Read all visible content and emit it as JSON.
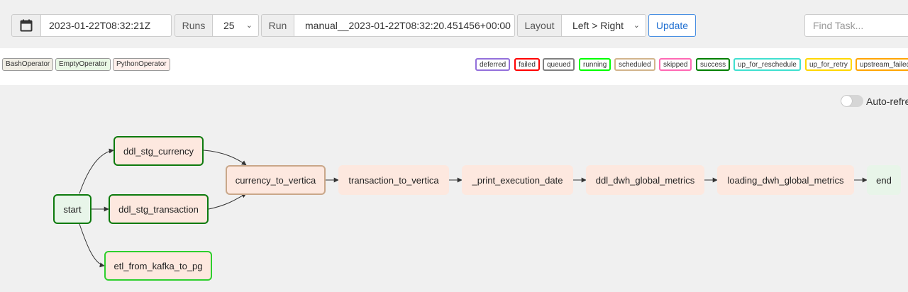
{
  "toolbar": {
    "date_value": "2023-01-22T08:32:21Z",
    "runs_label": "Runs",
    "runs_value": "25",
    "run_label": "Run",
    "run_value": "manual__2023-01-22T08:32:20.451456+00:00",
    "layout_label": "Layout",
    "layout_value": "Left > Right",
    "update_label": "Update",
    "find_placeholder": "Find Task..."
  },
  "operators": [
    {
      "label": "BashOperator",
      "bg": "#f0ede4"
    },
    {
      "label": "EmptyOperator",
      "bg": "#e8f7e4"
    },
    {
      "label": "PythonOperator",
      "bg": "#ffefeb"
    }
  ],
  "states": [
    {
      "label": "deferred",
      "color": "#9370db"
    },
    {
      "label": "failed",
      "color": "#ff0000"
    },
    {
      "label": "queued",
      "color": "#808080"
    },
    {
      "label": "running",
      "color": "#00ff00"
    },
    {
      "label": "scheduled",
      "color": "#d2b48c"
    },
    {
      "label": "skipped",
      "color": "#ff69b4"
    },
    {
      "label": "success",
      "color": "#008000"
    },
    {
      "label": "up_for_reschedule",
      "color": "#40e0d0"
    },
    {
      "label": "up_for_retry",
      "color": "#ffd700"
    },
    {
      "label": "upstream_failed",
      "color": "#ffa500"
    }
  ],
  "auto_refresh": {
    "label": "Auto-refresh",
    "enabled": false
  },
  "graph": {
    "nodes": [
      {
        "id": "start",
        "label": "start",
        "operator": "EmptyOperator",
        "state": "success"
      },
      {
        "id": "ddl_stg_currency",
        "label": "ddl_stg_currency",
        "operator": "PythonOperator",
        "state": "success"
      },
      {
        "id": "ddl_stg_transaction",
        "label": "ddl_stg_transaction",
        "operator": "PythonOperator",
        "state": "success"
      },
      {
        "id": "etl_from_kafka_to_pg",
        "label": "etl_from_kafka_to_pg",
        "operator": "PythonOperator",
        "state": "running"
      },
      {
        "id": "currency_to_vertica",
        "label": "currency_to_vertica",
        "operator": "PythonOperator",
        "state": "scheduled"
      },
      {
        "id": "transaction_to_vertica",
        "label": "transaction_to_vertica",
        "operator": "PythonOperator",
        "state": "none"
      },
      {
        "id": "_print_execution_date",
        "label": "_print_execution_date",
        "operator": "PythonOperator",
        "state": "none"
      },
      {
        "id": "ddl_dwh_global_metrics",
        "label": "ddl_dwh_global_metrics",
        "operator": "PythonOperator",
        "state": "none"
      },
      {
        "id": "loading_dwh_global_metrics",
        "label": "loading_dwh_global_metrics",
        "operator": "PythonOperator",
        "state": "none"
      },
      {
        "id": "end",
        "label": "end",
        "operator": "EmptyOperator",
        "state": "none"
      }
    ],
    "edges": [
      [
        "start",
        "ddl_stg_currency"
      ],
      [
        "start",
        "ddl_stg_transaction"
      ],
      [
        "start",
        "etl_from_kafka_to_pg"
      ],
      [
        "ddl_stg_currency",
        "currency_to_vertica"
      ],
      [
        "ddl_stg_transaction",
        "currency_to_vertica"
      ],
      [
        "currency_to_vertica",
        "transaction_to_vertica"
      ],
      [
        "transaction_to_vertica",
        "_print_execution_date"
      ],
      [
        "_print_execution_date",
        "ddl_dwh_global_metrics"
      ],
      [
        "ddl_dwh_global_metrics",
        "loading_dwh_global_metrics"
      ],
      [
        "loading_dwh_global_metrics",
        "end"
      ]
    ]
  }
}
